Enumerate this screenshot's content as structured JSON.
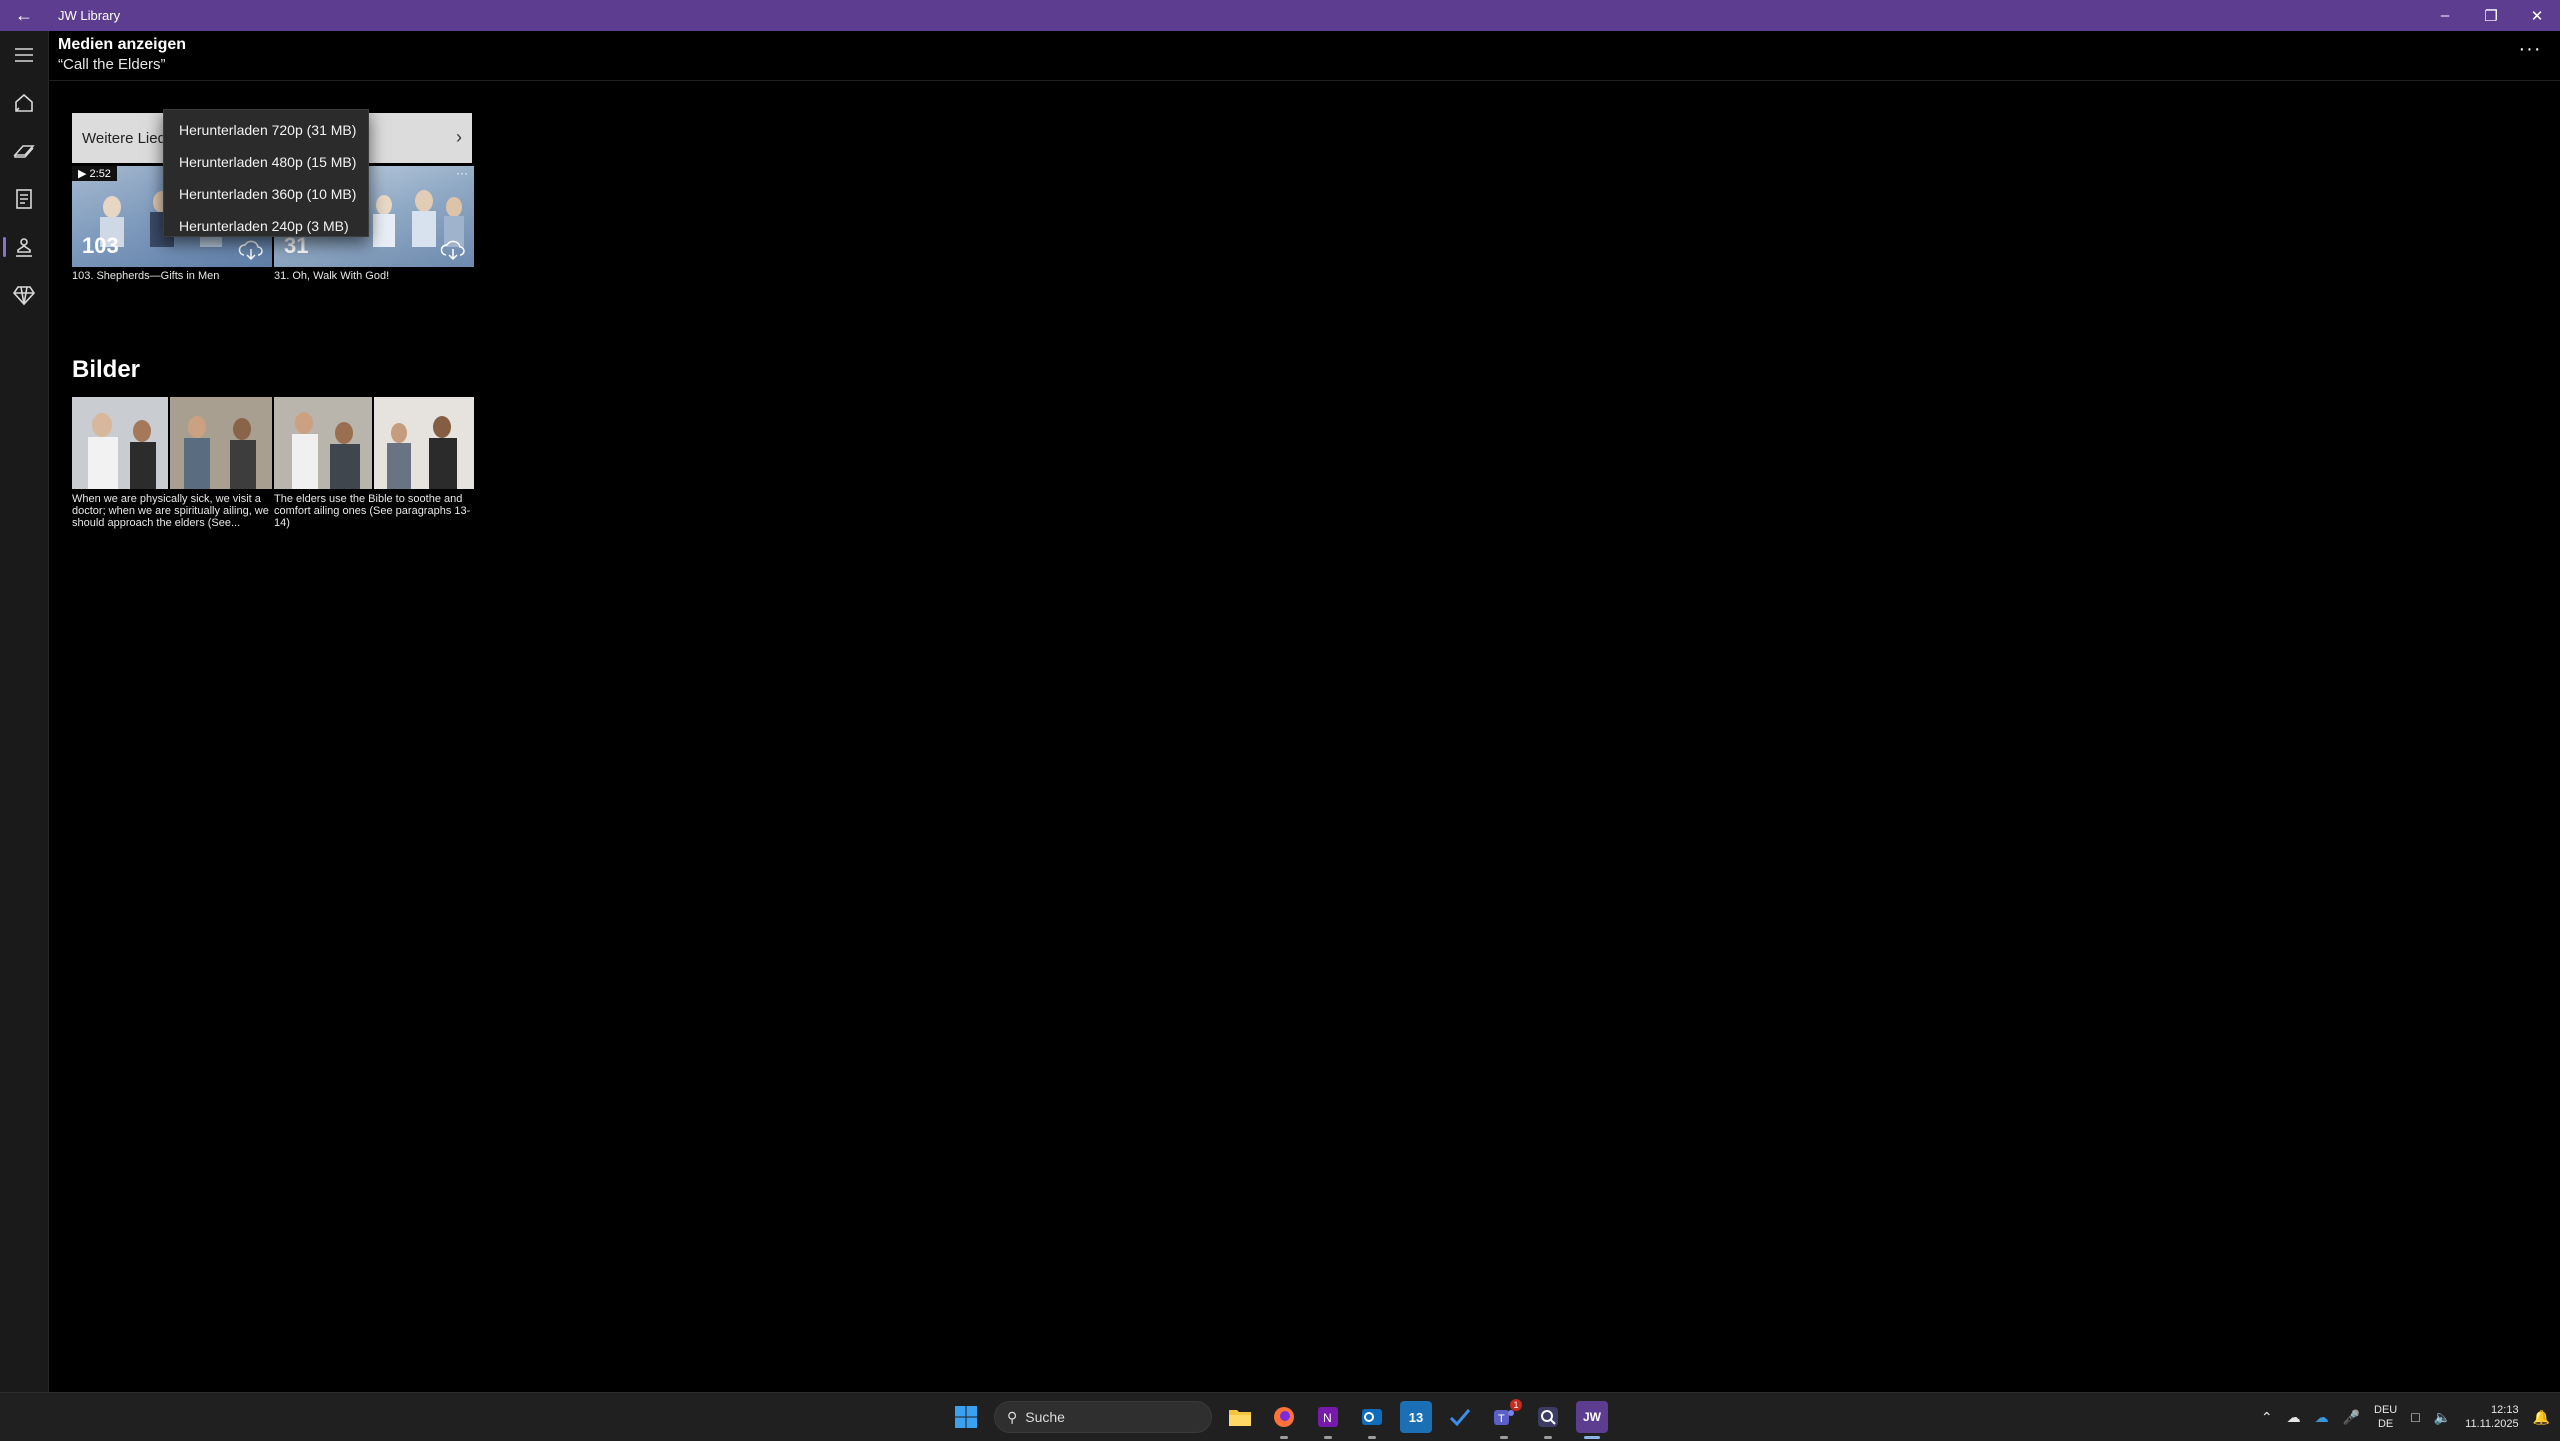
{
  "window": {
    "title": "JW Library",
    "back_icon": "back-arrow-icon",
    "controls": [
      "minimize-icon",
      "restore-icon",
      "close-icon"
    ]
  },
  "sidebar": {
    "items": [
      {
        "name": "menu",
        "icon": "hamburger-icon"
      },
      {
        "name": "home",
        "icon": "home-icon"
      },
      {
        "name": "bible",
        "icon": "bible-icon"
      },
      {
        "name": "publications",
        "icon": "publications-icon"
      },
      {
        "name": "meetings",
        "icon": "meetings-icon",
        "active": true
      },
      {
        "name": "personal-study",
        "icon": "gem-icon"
      }
    ]
  },
  "header": {
    "title": "Medien anzeigen",
    "subtitle": "“Call the Elders”",
    "more_label": "···"
  },
  "songs": {
    "more_bar_label": "Weitere Lieder",
    "videos": [
      {
        "number": "103",
        "duration": "▶ 2:52",
        "caption": "103. Shepherds—Gifts in Men"
      },
      {
        "number": "31",
        "duration": "",
        "menu": "···",
        "caption": "31. Oh, Walk With God!"
      }
    ]
  },
  "download_menu": {
    "items": [
      "Herunterladen 720p (31 MB)",
      "Herunterladen 480p (15 MB)",
      "Herunterladen 360p (10 MB)",
      "Herunterladen 240p (3 MB)"
    ]
  },
  "images": {
    "section_title": "Bilder",
    "items": [
      {
        "caption": "When we are physically sick, we visit a doctor; when we are spiritually ailing, we should approach the elders (See..."
      },
      {
        "caption": "The elders use the Bible to soothe and comfort ailing ones (See paragraphs 13-14)"
      }
    ]
  },
  "taskbar": {
    "search_placeholder": "Suche",
    "apps": [
      "windows-start-icon",
      "file-explorer-icon",
      "firefox-icon",
      "onenote-icon",
      "outlook-icon",
      "calendar-icon",
      "todo-icon",
      "teams-icon",
      "search-app-icon",
      "jw-library-icon"
    ],
    "calendar_day": "13",
    "teams_badge": "1",
    "jw_label": "JW",
    "tray": {
      "lang_top": "DEU",
      "lang_bottom": "DE",
      "time": "12:13",
      "date": "11.11.2025"
    }
  }
}
